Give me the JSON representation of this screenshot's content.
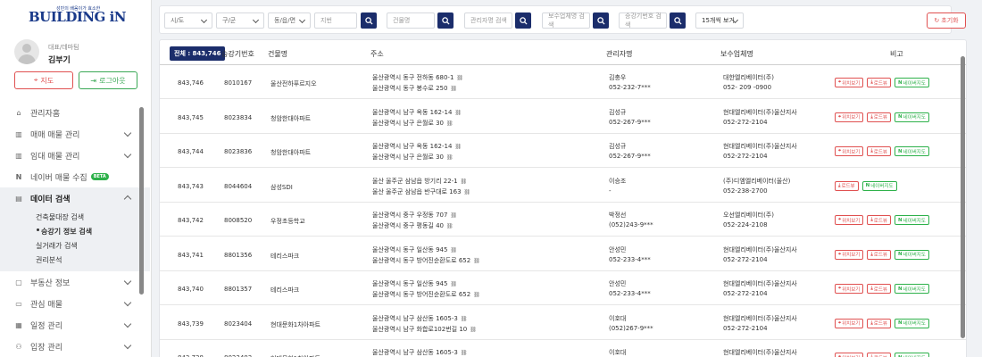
{
  "brand": {
    "tagline": "성민의 배움이가 효소한",
    "name": "BUILDING iN"
  },
  "profile": {
    "role": "대표/데마팀",
    "name": "김부기"
  },
  "side_buttons": {
    "map": "지도",
    "logout": "로그아웃"
  },
  "menu": [
    {
      "label": "관리자홈",
      "icon": "home-icon",
      "chev": false
    },
    {
      "label": "매매 매물 관리",
      "icon": "building-icon",
      "chev": true
    },
    {
      "label": "임대 매물 관리",
      "icon": "building-icon",
      "chev": true
    },
    {
      "label": "네이버 매물 수집",
      "icon": "naver-icon",
      "chev": false,
      "badge": "BETA"
    },
    {
      "label": "데이터 검색",
      "icon": "table-icon",
      "chev": true,
      "active": true
    }
  ],
  "submenu": [
    "건축물대장 검색",
    "승강기 정보 검색",
    "실거래가 검색",
    "권리분석"
  ],
  "menu_after": [
    {
      "label": "부동산 정보",
      "icon": "document-icon"
    },
    {
      "label": "관심 매물",
      "icon": "folder-icon"
    },
    {
      "label": "일정 관리",
      "icon": "calendar-icon"
    },
    {
      "label": "입장 관리",
      "icon": "people-icon"
    }
  ],
  "filters": {
    "sido": "시/도",
    "gugun": "구/군",
    "dong": "동/읍/면",
    "jibun_placeholder": "지번",
    "building_placeholder": "건물명",
    "manager_placeholder": "관리자명 검색",
    "maint_placeholder": "보수업체명 검색",
    "elevator_placeholder": "승강기번호 검색",
    "page_size": "15개씩 보기",
    "reset": "초기화"
  },
  "table": {
    "total": "전체 : 843,746",
    "headers": [
      "승강기번호",
      "건물명",
      "주소",
      "관리자명",
      "보수업체명",
      "비고"
    ],
    "rows": [
      {
        "no": "843,746",
        "elevator": "8010167",
        "building": "울산전하푸르지오",
        "addr1": "울산광역시 동구 전하동 680-1",
        "addr2": "울산광역시 동구 봉수로 250",
        "mgr1": "김충우",
        "mgr2": "052-232-7***",
        "mt1": "대한엘리베이터(주)",
        "mt2": "052- 209 -0900",
        "actions": [
          "위치보기",
          "로드뷰",
          "네이버지도"
        ]
      },
      {
        "no": "843,745",
        "elevator": "8023834",
        "building": "청암한대아파트",
        "addr1": "울산광역시 남구 옥동 162-14",
        "addr2": "울산광역시 남구 은월로 30",
        "mgr1": "김성규",
        "mgr2": "052-267-9***",
        "mt1": "현대엘리베이터(주)울산지사",
        "mt2": "052-272-2104",
        "actions": [
          "위치보기",
          "로드뷰",
          "네이버지도"
        ]
      },
      {
        "no": "843,744",
        "elevator": "8023836",
        "building": "청암한대아파트",
        "addr1": "울산광역시 남구 옥동 162-14",
        "addr2": "울산광역시 남구 은월로 30",
        "mgr1": "김성규",
        "mgr2": "052-267-9***",
        "mt1": "현대엘리베이터(주)울산지사",
        "mt2": "052-272-2104",
        "actions": [
          "위치보기",
          "로드뷰",
          "네이버지도"
        ]
      },
      {
        "no": "843,743",
        "elevator": "8044604",
        "building": "삼성SDI",
        "addr1": "울산 울주군 삼남읍 방기리 22-1",
        "addr2": "울산 울주군 삼남읍 반구대로 163",
        "mgr1": "이승조",
        "mgr2": "-",
        "mt1": "(주)디엠엘리베이터(울산)",
        "mt2": "052-238-2700",
        "actions": [
          "로드뷰",
          "네이버지도"
        ]
      },
      {
        "no": "843,742",
        "elevator": "8008520",
        "building": "우정초등학교",
        "addr1": "울산광역시 중구 우정동 707",
        "addr2": "울산광역시 중구 평동길 40",
        "mgr1": "박정선",
        "mgr2": "(052)243-9***",
        "mt1": "오선엘리베이터(주)",
        "mt2": "052-224-2108",
        "actions": [
          "위치보기",
          "로드뷰",
          "네이버지도"
        ]
      },
      {
        "no": "843,741",
        "elevator": "8801356",
        "building": "테리스파크",
        "addr1": "울산광역시 동구 일산동 945",
        "addr2": "울산광역시 동구 방어진순환도로 652",
        "mgr1": "안성민",
        "mgr2": "052-233-4***",
        "mt1": "현대엘리베이터(주)울산지사",
        "mt2": "052-272-2104",
        "actions": [
          "위치보기",
          "로드뷰",
          "네이버지도"
        ]
      },
      {
        "no": "843,740",
        "elevator": "8801357",
        "building": "테리스파크",
        "addr1": "울산광역시 동구 일산동 945",
        "addr2": "울산광역시 동구 방어진순환도로 652",
        "mgr1": "안성민",
        "mgr2": "052-233-4***",
        "mt1": "현대엘리베이터(주)울산지사",
        "mt2": "052-272-2104",
        "actions": [
          "위치보기",
          "로드뷰",
          "네이버지도"
        ]
      },
      {
        "no": "843,739",
        "elevator": "8023404",
        "building": "현대문화1차아파트",
        "addr1": "울산광역시 남구 삼산동 1605-3",
        "addr2": "울산광역시 남구 화합로102번길 10",
        "mgr1": "이호대",
        "mgr2": "(052)267-9***",
        "mt1": "현대엘리베이터(주)울산지사",
        "mt2": "052-272-2104",
        "actions": [
          "위치보기",
          "로드뷰",
          "네이버지도"
        ]
      },
      {
        "no": "843,738",
        "elevator": "8023403",
        "building": "현대문화1차아파트",
        "addr1": "울산광역시 남구 삼산동 1605-3",
        "addr2": "",
        "mgr1": "이호대",
        "mgr2": "",
        "mt1": "현대엘리베이터(주)울산지사",
        "mt2": "",
        "actions": [
          "위치보기",
          "로드뷰",
          "네이버지도"
        ]
      }
    ]
  },
  "colors": {
    "navy": "#1b2d6b",
    "red": "#e05050",
    "green": "#2db14a"
  }
}
